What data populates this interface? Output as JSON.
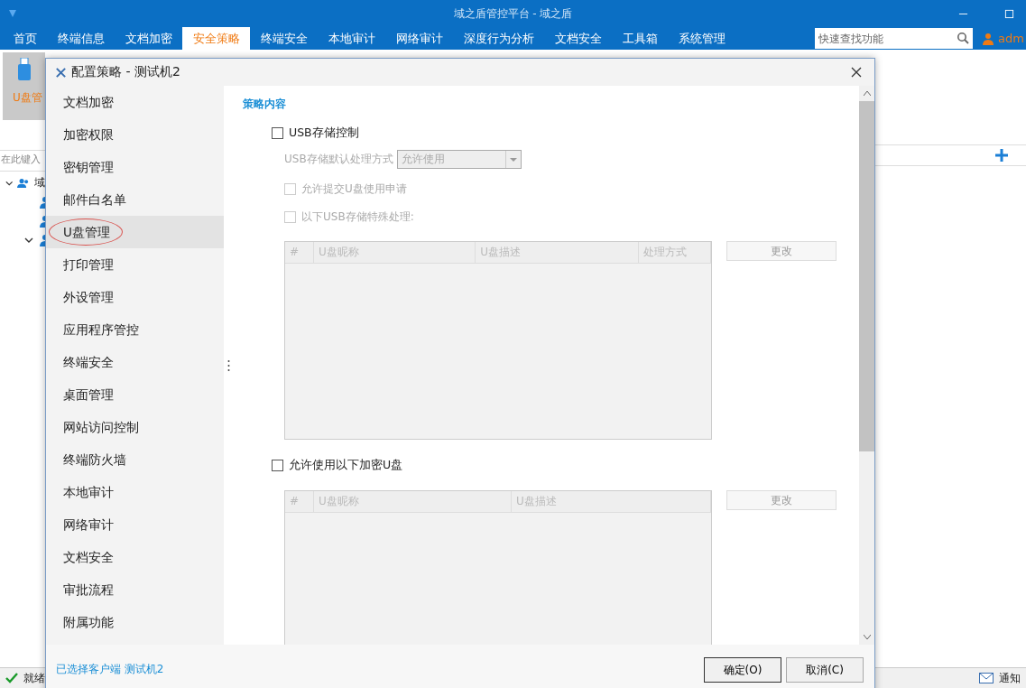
{
  "app": {
    "title": "域之盾管控平台 - 域之盾",
    "menu": [
      {
        "label": "首页",
        "selected": false
      },
      {
        "label": "终端信息",
        "selected": false
      },
      {
        "label": "文档加密",
        "selected": false
      },
      {
        "label": "安全策略",
        "selected": true
      },
      {
        "label": "终端安全",
        "selected": false
      },
      {
        "label": "本地审计",
        "selected": false
      },
      {
        "label": "网络审计",
        "selected": false
      },
      {
        "label": "深度行为分析",
        "selected": false
      },
      {
        "label": "文档安全",
        "selected": false
      },
      {
        "label": "工具箱",
        "selected": false
      },
      {
        "label": "系统管理",
        "selected": false
      }
    ],
    "search": {
      "placeholder": "快速查找功能"
    },
    "user": "adm",
    "toolbar_item": {
      "label": "U盘管",
      "selected": true
    },
    "filter": {
      "placeholder": "在此键入"
    },
    "tree_root": "域",
    "status": "就绪",
    "notice": "通知"
  },
  "dialog": {
    "title": "配置策略 - 测试机2",
    "nav": [
      {
        "label": "文档加密",
        "selected": false
      },
      {
        "label": "加密权限",
        "selected": false
      },
      {
        "label": "密钥管理",
        "selected": false
      },
      {
        "label": "邮件白名单",
        "selected": false
      },
      {
        "label": "U盘管理",
        "selected": true
      },
      {
        "label": "打印管理",
        "selected": false
      },
      {
        "label": "外设管理",
        "selected": false
      },
      {
        "label": "应用程序管控",
        "selected": false
      },
      {
        "label": "终端安全",
        "selected": false
      },
      {
        "label": "桌面管理",
        "selected": false
      },
      {
        "label": "网站访问控制",
        "selected": false
      },
      {
        "label": "终端防火墙",
        "selected": false
      },
      {
        "label": "本地审计",
        "selected": false
      },
      {
        "label": "网络审计",
        "selected": false
      },
      {
        "label": "文档安全",
        "selected": false
      },
      {
        "label": "审批流程",
        "selected": false
      },
      {
        "label": "附属功能",
        "selected": false
      }
    ],
    "section_title": "策略内容",
    "usb_control": {
      "label": "USB存储控制",
      "checked": false
    },
    "default_mode": {
      "label": "USB存储默认处理方式",
      "value": "允许使用",
      "disabled": true
    },
    "options": [
      {
        "label": "允许提交U盘使用申请",
        "checked": false,
        "disabled": true
      },
      {
        "label": "以下USB存储特殊处理:",
        "checked": false,
        "disabled": true
      }
    ],
    "table1": {
      "columns": [
        "#",
        "U盘昵称",
        "U盘描述",
        "处理方式"
      ],
      "button": "更改"
    },
    "encrypted": {
      "label": "允许使用以下加密U盘",
      "checked": false
    },
    "table2": {
      "columns": [
        "#",
        "U盘昵称",
        "U盘描述"
      ],
      "button": "更改"
    },
    "footer_note": "已选择客户端 测试机2",
    "buttons": [
      "确定(O)",
      "取消(C)"
    ]
  }
}
